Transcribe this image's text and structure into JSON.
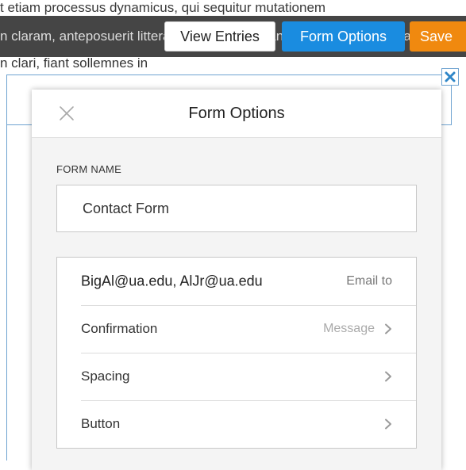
{
  "background": {
    "line_1": "t etiam processus dynamicus, qui sequitur mutationem",
    "line_2": "n claram, anteposuerit litterarum formas humanitatis per seacula quarta decima et",
    "line_3": "n clari, fiant sollemnes in"
  },
  "toolbar": {
    "view_entries_label": "View Entries",
    "form_options_label": "Form Options",
    "save_label": "Save"
  },
  "modal": {
    "title": "Form Options",
    "form_name_label": "FORM NAME",
    "form_name_value": "Contact Form",
    "rows": [
      {
        "label": "BigAl@ua.edu, AlJr@ua.edu",
        "value": "Email to"
      },
      {
        "label": "Confirmation",
        "value": "Message"
      },
      {
        "label": "Spacing",
        "value": ""
      },
      {
        "label": "Button",
        "value": ""
      }
    ]
  },
  "colors": {
    "primary": "#1a8ce0",
    "save": "#f0890f",
    "toolbar": "#454545",
    "frame": "#6fa3d1"
  },
  "icons": {
    "close": "x-icon",
    "chevron": "chevron-right-icon",
    "frame_close": "x-icon"
  }
}
